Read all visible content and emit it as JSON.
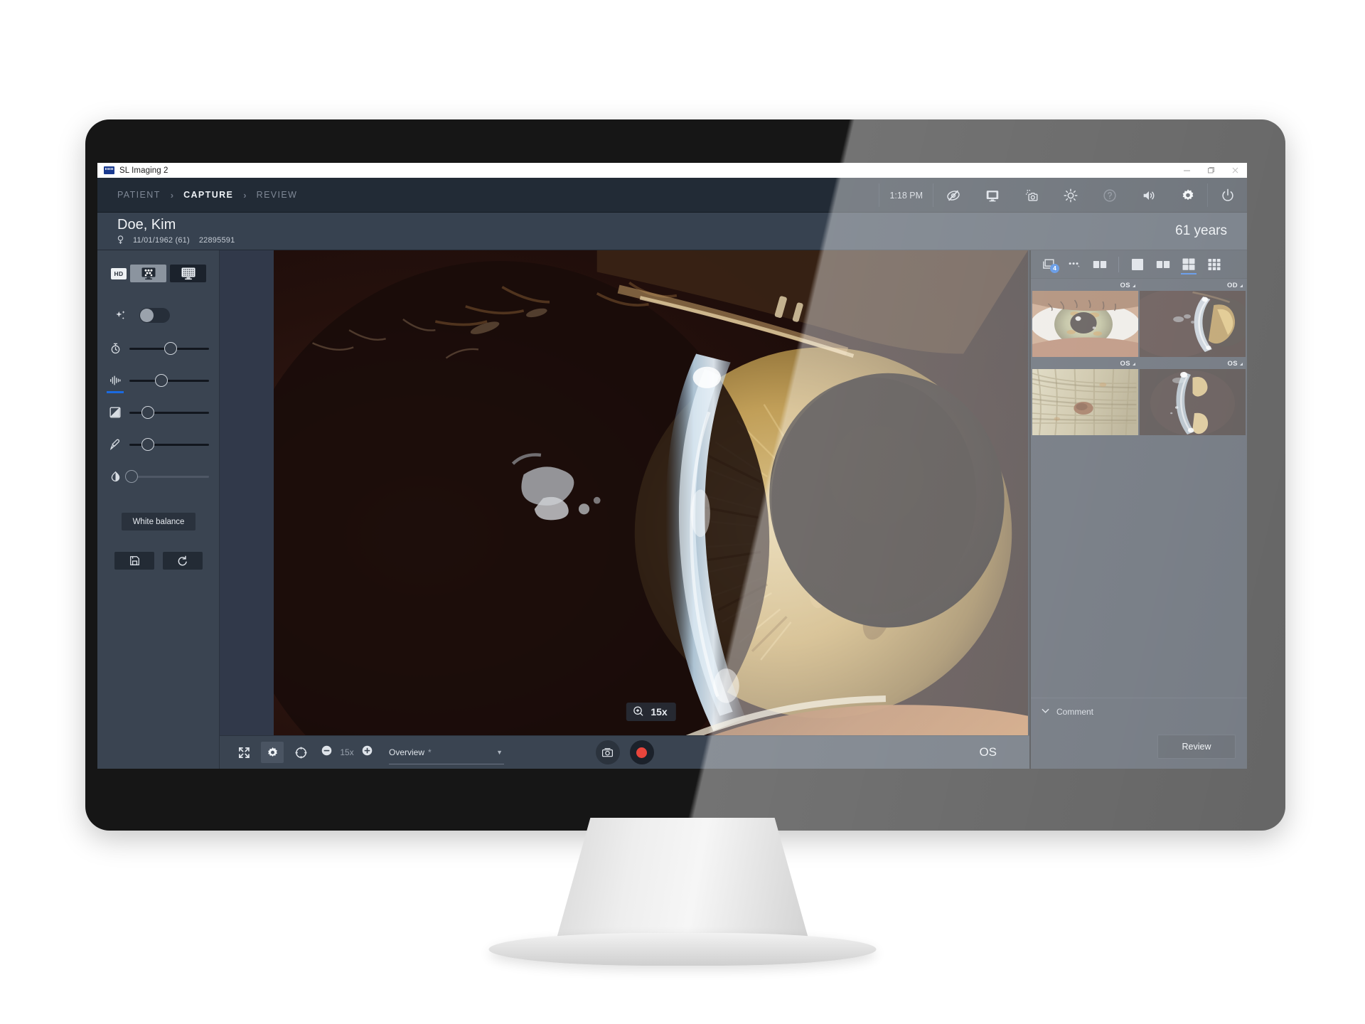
{
  "window": {
    "title": "SL Imaging 2",
    "controls": {
      "minimize": "minimize-icon",
      "maximize": "maximize-icon",
      "close": "close-icon"
    }
  },
  "nav": {
    "breadcrumb": [
      {
        "label": "PATIENT",
        "active": false
      },
      {
        "label": "CAPTURE",
        "active": true
      },
      {
        "label": "REVIEW",
        "active": false
      }
    ],
    "separator": "›",
    "time": "1:18 PM",
    "tools": [
      {
        "name": "eye-off-icon",
        "title": "Hide overlay"
      },
      {
        "name": "display-icon",
        "title": "Display"
      },
      {
        "name": "camera-focus-icon",
        "title": "Camera focus"
      },
      {
        "name": "brightness-icon",
        "title": "Brightness"
      },
      {
        "name": "help-icon",
        "title": "Help"
      },
      {
        "name": "volume-icon",
        "title": "Volume"
      },
      {
        "name": "settings-gear-icon",
        "title": "Settings"
      },
      {
        "name": "power-icon",
        "title": "Power"
      }
    ]
  },
  "patient": {
    "name": "Doe, Kim",
    "gender": "female",
    "dob": "11/01/1962 (61)",
    "id": "22895591",
    "age_display": "61 years"
  },
  "left_panel": {
    "hd_badge": "HD",
    "mode_buttons": [
      {
        "name": "display-mode-color",
        "selected": true
      },
      {
        "name": "display-mode-fine",
        "selected": false
      }
    ],
    "enhance_toggle": {
      "icon": "sparkle-icon",
      "state": "off"
    },
    "sliders": [
      {
        "name": "exposure-time-slider",
        "icon": "stopwatch-icon",
        "value": 52,
        "accent": false
      },
      {
        "name": "sharpness-slider",
        "icon": "waveform-icon",
        "value": 40,
        "accent": true
      },
      {
        "name": "exposure-compensation-slider",
        "icon": "exposure-icon",
        "value": 23,
        "accent": false
      },
      {
        "name": "eyedropper-slider",
        "icon": "eyedropper-icon",
        "value": 23,
        "accent": false
      },
      {
        "name": "contrast-slider",
        "icon": "contrast-icon",
        "value": 2,
        "accent": false
      }
    ],
    "white_balance_label": "White balance",
    "save_button": {
      "icon": "save-floppy-icon"
    },
    "reset_button": {
      "icon": "reset-undo-icon"
    }
  },
  "viewer": {
    "zoom_badge": {
      "icon": "zoom-in-icon",
      "label": "15x"
    },
    "eye_label": "OS"
  },
  "bottom_bar": {
    "fullscreen": {
      "icon": "expand-icon"
    },
    "settings": {
      "icon": "gear-icon",
      "selected": true
    },
    "target": {
      "icon": "crosshair-icon"
    },
    "zoom_out": {
      "icon": "minus-circle-icon"
    },
    "zoom_value": "15x",
    "zoom_in": {
      "icon": "plus-circle-icon"
    },
    "preset_label": "Overview",
    "preset_modified_marker": "*",
    "capture_photo": {
      "icon": "camera-icon"
    },
    "capture_record": {
      "icon": "record-icon"
    }
  },
  "right_panel": {
    "toolbar": {
      "gallery": {
        "icon": "images-stack-icon",
        "badge": "4"
      },
      "more": {
        "icon": "more-dots-icon"
      },
      "compare": {
        "icon": "compare-split-icon"
      },
      "layouts": [
        {
          "name": "layout-single-icon",
          "selected": false
        },
        {
          "name": "layout-two-icon",
          "selected": false
        },
        {
          "name": "layout-four-icon",
          "selected": true
        },
        {
          "name": "layout-nine-icon",
          "selected": false
        }
      ]
    },
    "thumbnails": [
      {
        "label": "OS",
        "kind": "iris-full"
      },
      {
        "label": "OD",
        "kind": "slit-beam"
      },
      {
        "label": "OS",
        "kind": "iris-detail"
      },
      {
        "label": "OS",
        "kind": "slit-vertical"
      }
    ],
    "comment_label": "Comment",
    "comment_chevron": "chevron-down-icon",
    "review_button_label": "Review"
  },
  "colors": {
    "accent": "#1b6ae0",
    "badge": "#1565d8",
    "record": "#e8453c",
    "panel": "#3a4451",
    "nav": "#222b36",
    "patient_bar": "#374250",
    "right_panel": "#2f3845"
  }
}
